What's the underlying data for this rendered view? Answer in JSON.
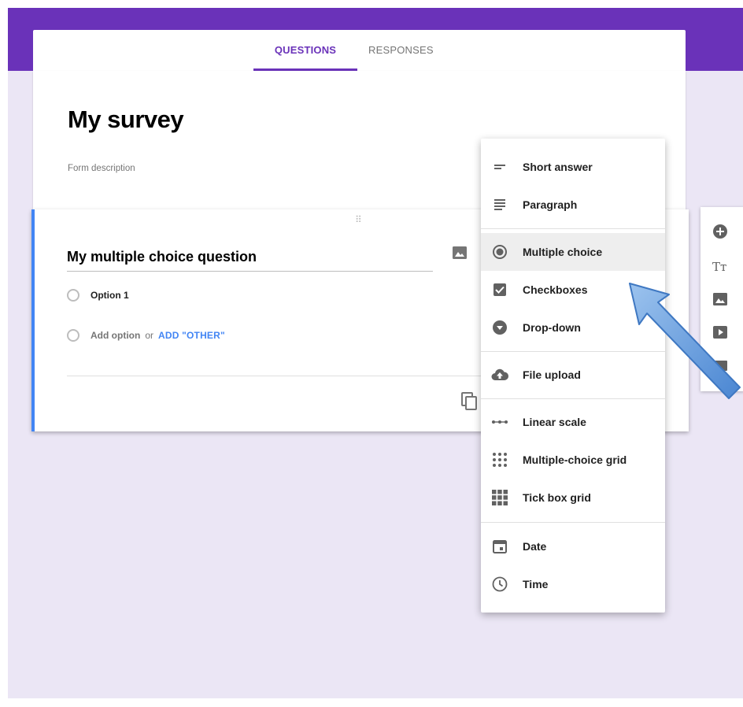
{
  "tabs": {
    "questions": "QUESTIONS",
    "responses": "RESPONSES"
  },
  "form": {
    "title": "My survey",
    "description_placeholder": "Form description"
  },
  "question": {
    "title": "My multiple choice question",
    "options": [
      "Option 1"
    ],
    "add_option": "Add option",
    "or": "or",
    "add_other": "ADD \"OTHER\""
  },
  "menu": {
    "items": [
      {
        "label": "Short answer",
        "icon": "short-answer-icon"
      },
      {
        "label": "Paragraph",
        "icon": "paragraph-icon"
      },
      {
        "label": "Multiple choice",
        "icon": "radio-button-icon",
        "selected": true
      },
      {
        "label": "Checkboxes",
        "icon": "checkbox-icon"
      },
      {
        "label": "Drop-down",
        "icon": "dropdown-icon"
      },
      {
        "label": "File upload",
        "icon": "cloud-upload-icon"
      },
      {
        "label": "Linear scale",
        "icon": "linear-scale-icon"
      },
      {
        "label": "Multiple-choice grid",
        "icon": "dot-grid-icon"
      },
      {
        "label": "Tick box grid",
        "icon": "checkbox-grid-icon"
      },
      {
        "label": "Date",
        "icon": "calendar-icon"
      },
      {
        "label": "Time",
        "icon": "clock-icon"
      }
    ]
  },
  "toolbar": {
    "icons": [
      "add-question-icon",
      "title-text-icon",
      "image-icon",
      "video-icon",
      "section-icon"
    ]
  },
  "colors": {
    "accent": "#6a32b9",
    "background": "#ebe6f5",
    "question_border": "#4285f4",
    "link": "#4285f4"
  }
}
